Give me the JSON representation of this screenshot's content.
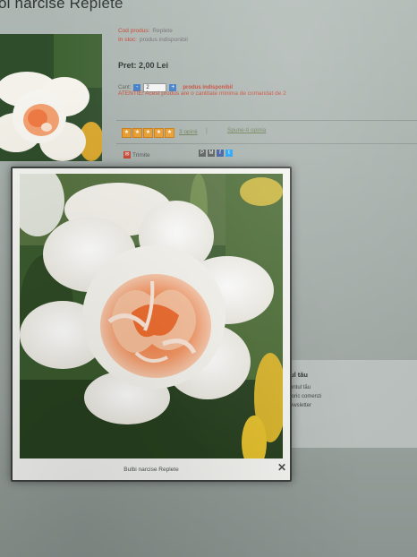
{
  "page": {
    "title": "oi narcise Replete"
  },
  "product": {
    "code_label": "Cod produs:",
    "code_value": "Replete",
    "stock_label": "In stoc:",
    "stock_value": "produs indisponibil",
    "price": "Pret: 2,00 Lei",
    "qty_label": "Cant:",
    "qty_value": "2",
    "qty_status": "produs indisponibil",
    "warning": "ATENTIE! Acest produs are o cantitate minima de comandat de 2",
    "reviews_link": "3 opinii",
    "reviews_separator": "|",
    "write_review_link": "Spune-ti opinia",
    "send_label": "Trimite",
    "rating": 5,
    "star_color": "#e89b2a"
  },
  "share_icons": [
    {
      "name": "print-icon",
      "glyph": "P",
      "color": "#555a58"
    },
    {
      "name": "email-icon",
      "glyph": "M",
      "color": "#555a58"
    },
    {
      "name": "facebook-icon",
      "glyph": "f",
      "color": "#3b5998"
    },
    {
      "name": "twitter-icon",
      "glyph": "t",
      "color": "#1da1f2"
    }
  ],
  "account": {
    "title": "ul tău",
    "items": [
      "ontul tău",
      "toric comenzi",
      "ewsletter"
    ]
  },
  "lightbox": {
    "caption": "Bulbi narcise Replete",
    "close_icon": "✕"
  },
  "colors": {
    "accent_red": "#c3412e",
    "link_green": "#6a7d52",
    "button_blue": "#3a7bc8"
  }
}
